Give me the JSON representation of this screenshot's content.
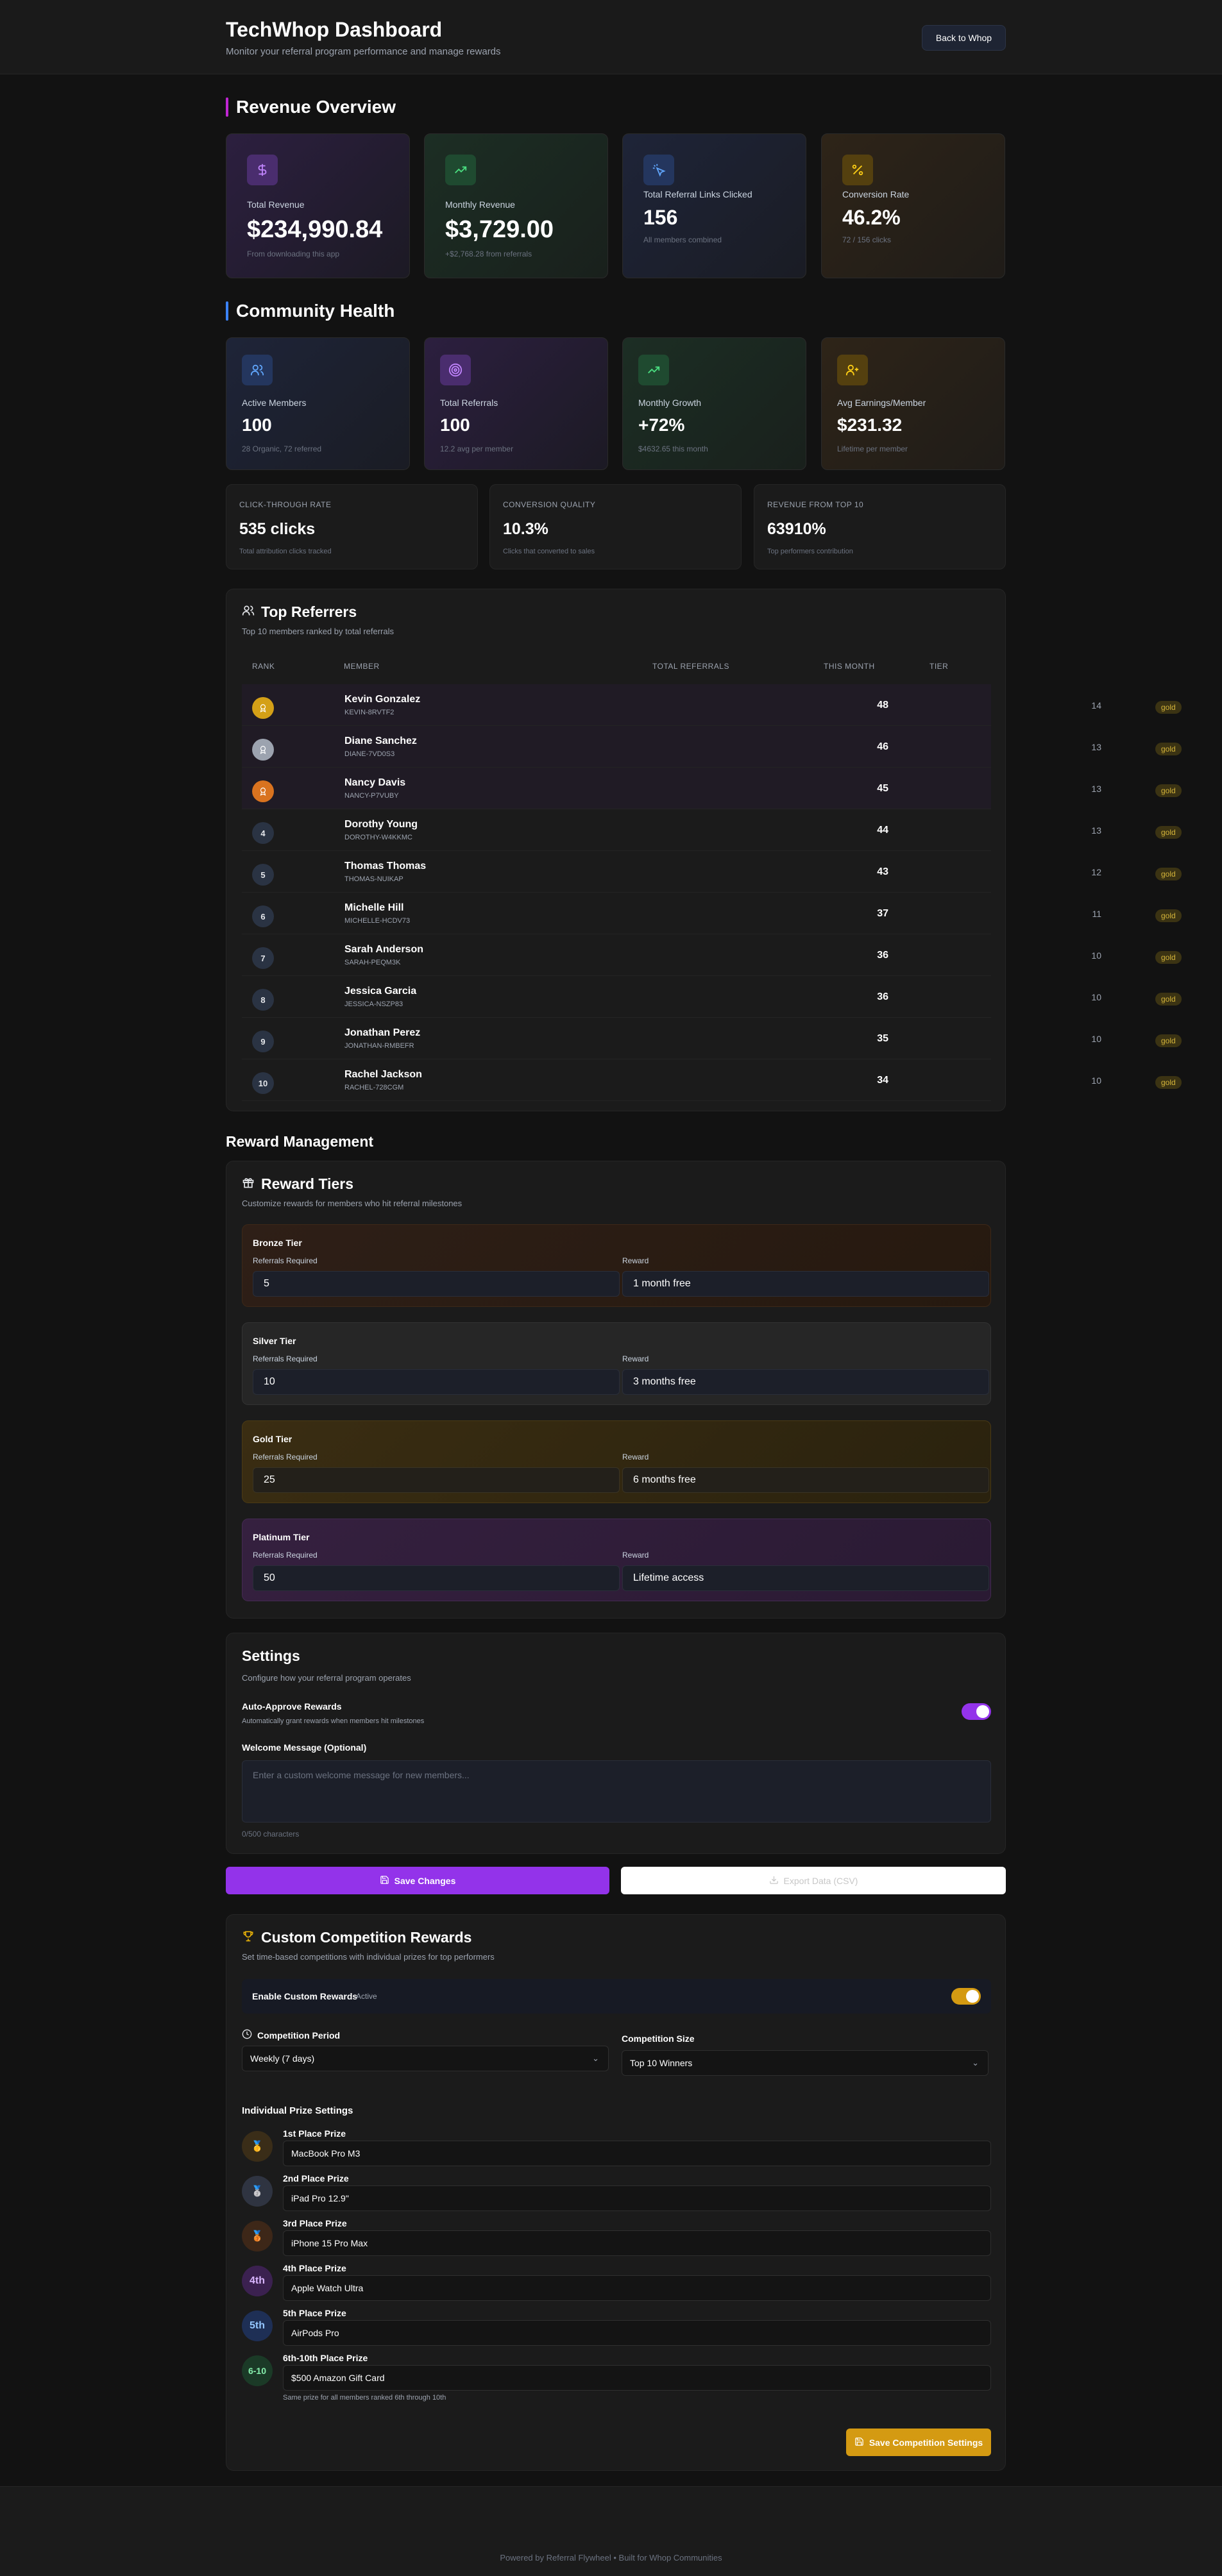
{
  "header": {
    "title": "TechWhop Dashboard",
    "subtitle": "Monitor your referral program performance and manage rewards",
    "back_button": "Back to Whop"
  },
  "revenue": {
    "heading": "Revenue Overview",
    "cards": [
      {
        "label": "Total Revenue",
        "value": "$234,990.84",
        "sub": "From downloading this app",
        "icon": "dollar-icon"
      },
      {
        "label": "Monthly Revenue",
        "value": "$3,729.00",
        "sub": "+$2,768.28 from referrals",
        "icon": "trend-up-icon"
      },
      {
        "label": "Total Referral Links Clicked",
        "value": "156",
        "sub": "All members combined",
        "icon": "cursor-click-icon"
      },
      {
        "label": "Conversion Rate",
        "value": "46.2%",
        "sub": "72 / 156 clicks",
        "icon": "percent-icon"
      }
    ]
  },
  "community": {
    "heading": "Community Health",
    "cards": [
      {
        "label": "Active Members",
        "value": "100",
        "sub": "28 Organic, 72 referred",
        "icon": "users-icon"
      },
      {
        "label": "Total Referrals",
        "value": "100",
        "sub": "12.2 avg per member",
        "icon": "target-icon"
      },
      {
        "label": "Monthly Growth",
        "value": "+72%",
        "sub": "$4632.65 this month",
        "icon": "trend-up-icon"
      },
      {
        "label": "Avg Earnings/Member",
        "value": "$231.32",
        "sub": "Lifetime per member",
        "icon": "user-plus-icon"
      }
    ],
    "mini": [
      {
        "label": "CLICK-THROUGH RATE",
        "value": "535 clicks",
        "sub": "Total attribution clicks tracked"
      },
      {
        "label": "CONVERSION QUALITY",
        "value": "10.3%",
        "sub": "Clicks that converted to sales"
      },
      {
        "label": "REVENUE FROM TOP 10",
        "value": "63910%",
        "sub": "Top performers contribution"
      }
    ]
  },
  "referrers": {
    "title": "Top Referrers",
    "subtitle": "Top 10 members ranked by total referrals",
    "columns": {
      "rank": "RANK",
      "member": "MEMBER",
      "total": "TOTAL REFERRALS",
      "month": "THIS MONTH",
      "tier": "TIER"
    },
    "rows": [
      {
        "rank": "1",
        "name": "Kevin Gonzalez",
        "code": "KEVIN-8RVTF2",
        "total": "48",
        "month": "14",
        "tier": "gold"
      },
      {
        "rank": "2",
        "name": "Diane Sanchez",
        "code": "DIANE-7VD0S3",
        "total": "46",
        "month": "13",
        "tier": "gold"
      },
      {
        "rank": "3",
        "name": "Nancy Davis",
        "code": "NANCY-P7VUBY",
        "total": "45",
        "month": "13",
        "tier": "gold"
      },
      {
        "rank": "4",
        "name": "Dorothy Young",
        "code": "DOROTHY-W4KKMC",
        "total": "44",
        "month": "13",
        "tier": "gold"
      },
      {
        "rank": "5",
        "name": "Thomas Thomas",
        "code": "THOMAS-NUIKAP",
        "total": "43",
        "month": "12",
        "tier": "gold"
      },
      {
        "rank": "6",
        "name": "Michelle Hill",
        "code": "MICHELLE-HCDV73",
        "total": "37",
        "month": "11",
        "tier": "gold"
      },
      {
        "rank": "7",
        "name": "Sarah Anderson",
        "code": "SARAH-PEQM3K",
        "total": "36",
        "month": "10",
        "tier": "gold"
      },
      {
        "rank": "8",
        "name": "Jessica Garcia",
        "code": "JESSICA-NSZP83",
        "total": "36",
        "month": "10",
        "tier": "gold"
      },
      {
        "rank": "9",
        "name": "Jonathan Perez",
        "code": "JONATHAN-RMBEFR",
        "total": "35",
        "month": "10",
        "tier": "gold"
      },
      {
        "rank": "10",
        "name": "Rachel Jackson",
        "code": "RACHEL-728CGM",
        "total": "34",
        "month": "10",
        "tier": "gold"
      }
    ]
  },
  "rewards": {
    "heading": "Reward Management",
    "title": "Reward Tiers",
    "subtitle": "Customize rewards for members who hit referral milestones",
    "field_referrals": "Referrals Required",
    "field_reward": "Reward",
    "tiers": [
      {
        "name": "Bronze Tier",
        "referrals": "5",
        "reward": "1 month free"
      },
      {
        "name": "Silver Tier",
        "referrals": "10",
        "reward": "3 months free"
      },
      {
        "name": "Gold Tier",
        "referrals": "25",
        "reward": "6 months free"
      },
      {
        "name": "Platinum Tier",
        "referrals": "50",
        "reward": "Lifetime access"
      }
    ]
  },
  "settings": {
    "title": "Settings",
    "subtitle": "Configure how your referral program operates",
    "auto_label": "Auto-Approve Rewards",
    "auto_sub": "Automatically grant rewards when members hit milestones",
    "welcome_label": "Welcome Message (Optional)",
    "welcome_placeholder": "Enter a custom welcome message for new members...",
    "char_count": "0/500 characters"
  },
  "actions": {
    "save": "Save Changes",
    "export": "Export Data (CSV)"
  },
  "competition": {
    "title": "Custom Competition Rewards",
    "subtitle": "Set time-based competitions with individual prizes for top performers",
    "enable_label": "Enable Custom Rewards",
    "enable_status": "Active",
    "period_label": "Competition Period",
    "period_value": "Weekly (7 days)",
    "size_label": "Competition Size",
    "size_value": "Top 10 Winners",
    "prize_heading": "Individual Prize Settings",
    "prizes": [
      {
        "badge": "🥇",
        "label": "1st Place Prize",
        "value": "MacBook Pro M3"
      },
      {
        "badge": "🥈",
        "label": "2nd Place Prize",
        "value": "iPad Pro 12.9\""
      },
      {
        "badge": "🥉",
        "label": "3rd Place Prize",
        "value": "iPhone 15 Pro Max"
      },
      {
        "badge": "4th",
        "label": "4th Place Prize",
        "value": "Apple Watch Ultra"
      },
      {
        "badge": "5th",
        "label": "5th Place Prize",
        "value": "AirPods Pro"
      },
      {
        "badge": "6-10",
        "label": "6th-10th Place Prize",
        "value": "$500 Amazon Gift Card"
      }
    ],
    "prize_note": "Same prize for all members ranked 6th through 10th",
    "save_button": "Save Competition Settings"
  },
  "footer": {
    "text": "Powered by Referral Flywheel • Built for Whop Communities"
  },
  "colors": {
    "accent_purple": "#9333ea",
    "accent_gold": "#d49a12",
    "background": "#121212"
  }
}
